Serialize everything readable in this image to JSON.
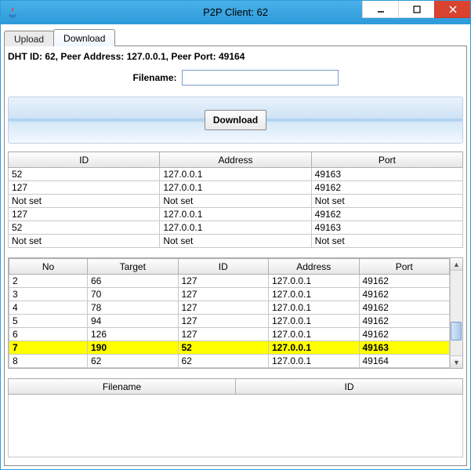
{
  "window": {
    "title": "P2P Client: 62"
  },
  "tabs": {
    "upload": "Upload",
    "download": "Download"
  },
  "peer_info": "DHT ID: 62, Peer Address: 127.0.0.1, Peer Port: 49164",
  "filename_label": "Filename:",
  "filename_value": "",
  "download_button": "Download",
  "peers": {
    "headers": {
      "id": "ID",
      "address": "Address",
      "port": "Port"
    },
    "rows": [
      {
        "id": "52",
        "address": "127.0.0.1",
        "port": "49163"
      },
      {
        "id": "127",
        "address": "127.0.0.1",
        "port": "49162"
      },
      {
        "id": "Not set",
        "address": "Not set",
        "port": "Not set"
      },
      {
        "id": "127",
        "address": "127.0.0.1",
        "port": "49162"
      },
      {
        "id": "52",
        "address": "127.0.0.1",
        "port": "49163"
      },
      {
        "id": "Not set",
        "address": "Not set",
        "port": "Not set"
      }
    ]
  },
  "log": {
    "headers": {
      "no": "No",
      "target": "Target",
      "id": "ID",
      "address": "Address",
      "port": "Port"
    },
    "rows": [
      {
        "no": "2",
        "target": "66",
        "id": "127",
        "address": "127.0.0.1",
        "port": "49162",
        "hl": false
      },
      {
        "no": "3",
        "target": "70",
        "id": "127",
        "address": "127.0.0.1",
        "port": "49162",
        "hl": false
      },
      {
        "no": "4",
        "target": "78",
        "id": "127",
        "address": "127.0.0.1",
        "port": "49162",
        "hl": false
      },
      {
        "no": "5",
        "target": "94",
        "id": "127",
        "address": "127.0.0.1",
        "port": "49162",
        "hl": false
      },
      {
        "no": "6",
        "target": "126",
        "id": "127",
        "address": "127.0.0.1",
        "port": "49162",
        "hl": false
      },
      {
        "no": "7",
        "target": "190",
        "id": "52",
        "address": "127.0.0.1",
        "port": "49163",
        "hl": true
      },
      {
        "no": "8",
        "target": "62",
        "id": "62",
        "address": "127.0.0.1",
        "port": "49164",
        "hl": false
      }
    ]
  },
  "files": {
    "headers": {
      "filename": "Filename",
      "id": "ID"
    }
  }
}
